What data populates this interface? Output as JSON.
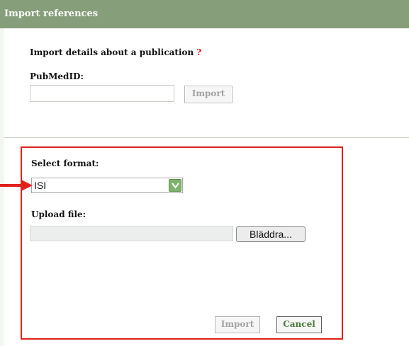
{
  "dialog": {
    "title": "Import references"
  },
  "pubmed_section": {
    "heading": "Import details about a publication",
    "help": "?",
    "id_label": "PubMedID:",
    "id_value": "",
    "import_label": "Import"
  },
  "file_section": {
    "format_label": "Select format:",
    "format_selected": "ISI",
    "upload_label": "Upload file:",
    "file_value": "",
    "browse_label": "Bläddra...",
    "import_label": "Import",
    "cancel_label": "Cancel"
  },
  "annotation": {
    "frame_color": "#e0201c",
    "arrow_color": "#e0201c"
  },
  "colors": {
    "titlebar": "#869e79",
    "dropdown_accent": "#7db36a"
  }
}
